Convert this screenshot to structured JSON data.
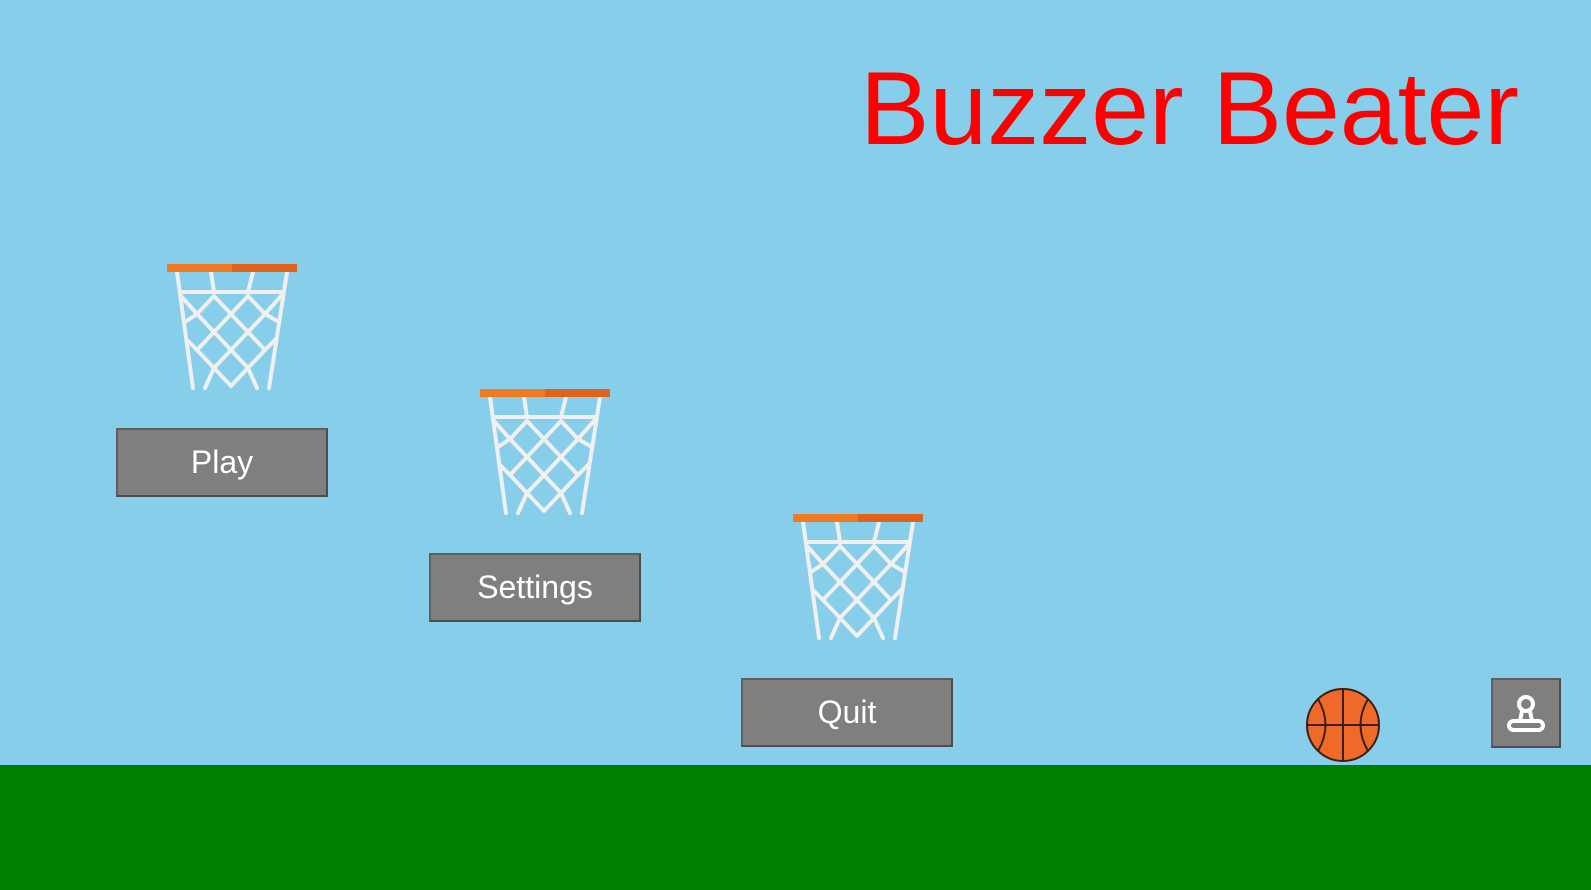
{
  "game": {
    "title": "Buzzer Beater"
  },
  "menu": {
    "play_label": "Play",
    "settings_label": "Settings",
    "quit_label": "Quit"
  },
  "icons": {
    "profile": "person-icon",
    "hoop": "basketball-hoop-icon",
    "ball": "basketball-icon"
  },
  "colors": {
    "sky": "#87ceea",
    "ground": "#007f00",
    "title": "#ff0000",
    "button": "#7f7f7f",
    "button_text": "#ffffff",
    "rim": "#ef7a22",
    "rim_dark": "#e0621b",
    "net": "#f0f0f0",
    "ball": "#ef6a2a"
  }
}
